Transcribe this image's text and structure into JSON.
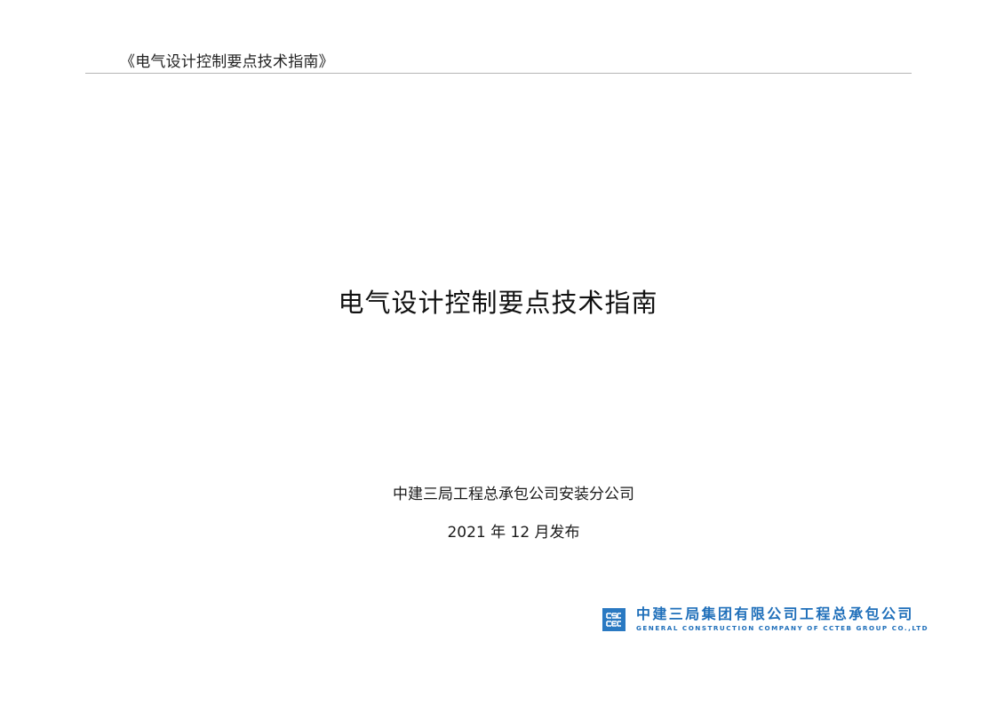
{
  "header": {
    "running_title": "《电气设计控制要点技术指南》"
  },
  "cover": {
    "title": "电气设计控制要点技术指南",
    "issuer": "中建三局工程总承包公司安装分公司",
    "date": "2021 年 12 月发布"
  },
  "logo": {
    "name_cn": "中建三局集团有限公司工程总承包公司",
    "name_en": "GENERAL CONSTRUCTION  COMPANY OF CCTEB GROUP  CO.,LTD",
    "brand_color": "#1f6fba",
    "icon": "cscec-logo-icon"
  }
}
